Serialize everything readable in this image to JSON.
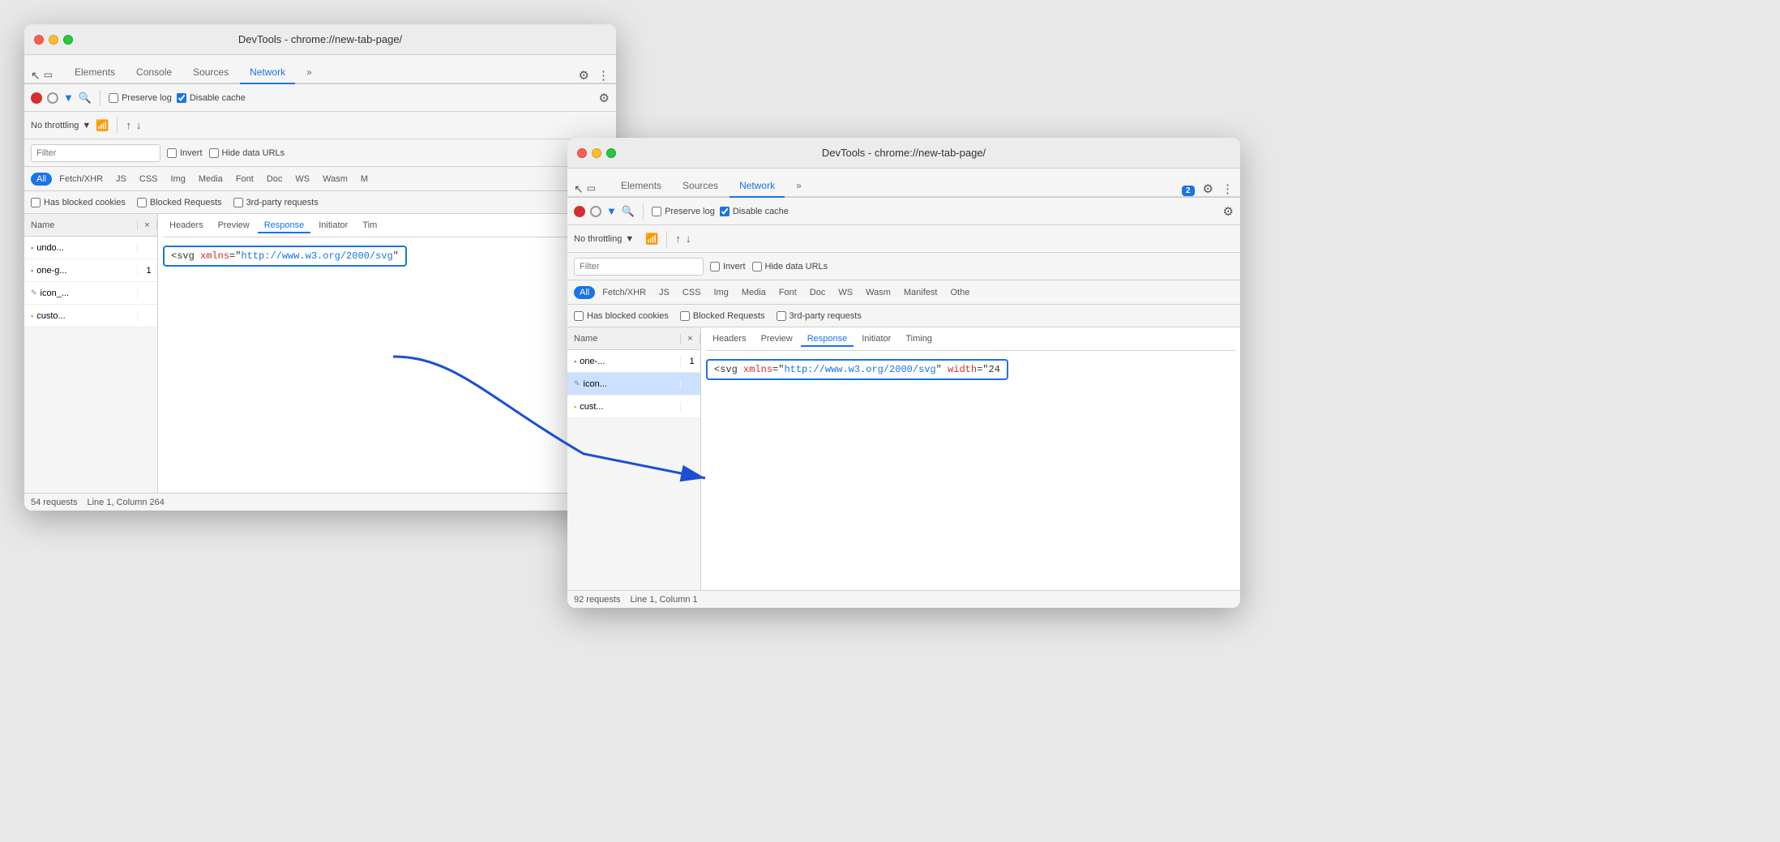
{
  "window1": {
    "title": "DevTools - chrome://new-tab-page/",
    "tabs": [
      "Elements",
      "Console",
      "Sources",
      "Network",
      "»"
    ],
    "active_tab": "Network",
    "toolbar": {
      "record": "●",
      "stop": "⊘",
      "filter": "▼",
      "search": "🔍",
      "preserve_log": "Preserve log",
      "disable_cache": "Disable cache",
      "throttle": "No throttling",
      "import": "↑",
      "export": "↓"
    },
    "filter_placeholder": "Filter",
    "invert_label": "Invert",
    "hide_data_label": "Hide data URLs",
    "type_filters": [
      "All",
      "Fetch/XHR",
      "JS",
      "CSS",
      "Img",
      "Media",
      "Font",
      "Doc",
      "WS",
      "Wasm",
      "M"
    ],
    "checks": [
      "Has blocked cookies",
      "Blocked Requests",
      "3rd-party requests"
    ],
    "table_cols": [
      "Name",
      "×",
      "Headers",
      "Preview",
      "Response",
      "Initiator",
      "Tim"
    ],
    "rows": [
      {
        "icon": "page",
        "name": "undo...",
        "selected": false
      },
      {
        "icon": "doc",
        "name": "one-g...",
        "number": "1",
        "selected": false
      },
      {
        "icon": "script",
        "name": "icon_...",
        "selected": false
      },
      {
        "icon": "img",
        "name": "custo...",
        "selected": false
      }
    ],
    "response_code": "<svg xmlns=\"http://www.w3.org/2000/svg\"",
    "status_bar": {
      "requests": "54 requests",
      "position": "Line 1, Column 264"
    }
  },
  "window2": {
    "title": "DevTools - chrome://new-tab-page/",
    "tabs": [
      "Elements",
      "Sources",
      "Network",
      "»"
    ],
    "active_tab": "Network",
    "badge": "2",
    "toolbar": {
      "preserve_log": "Preserve log",
      "disable_cache": "Disable cache",
      "throttle": "No throttling"
    },
    "filter_placeholder": "Filter",
    "invert_label": "Invert",
    "hide_data_label": "Hide data URLs",
    "type_filters": [
      "All",
      "Fetch/XHR",
      "JS",
      "CSS",
      "Img",
      "Media",
      "Font",
      "Doc",
      "WS",
      "Wasm",
      "Manifest",
      "Othe"
    ],
    "checks": [
      "Has blocked cookies",
      "Blocked Requests",
      "3rd-party requests"
    ],
    "table_cols": [
      "Name",
      "×",
      "Headers",
      "Preview",
      "Response",
      "Initiator",
      "Timing"
    ],
    "rows": [
      {
        "icon": "doc",
        "name": "one-...",
        "number": "1",
        "selected": false
      },
      {
        "icon": "script",
        "name": "icon...",
        "selected": true
      },
      {
        "icon": "img",
        "name": "cust...",
        "selected": false
      }
    ],
    "response_code": "<svg xmlns=\"http://www.w3.org/2000/svg\" width=\"24",
    "status_bar": {
      "requests": "92 requests",
      "position": "Line 1, Column 1"
    }
  }
}
